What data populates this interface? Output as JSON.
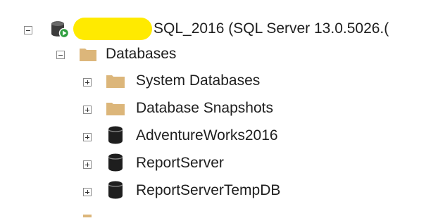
{
  "tree": {
    "server": {
      "label": "SQL_2016 (SQL Server 13.0.5026.(",
      "icon": "database-server-running-icon",
      "expanded": true
    },
    "databases_folder": {
      "label": "Databases",
      "icon": "folder-icon",
      "expanded": true
    },
    "children": [
      {
        "label": "System Databases",
        "icon": "folder-icon",
        "expanded": false
      },
      {
        "label": "Database Snapshots",
        "icon": "folder-icon",
        "expanded": false
      },
      {
        "label": "AdventureWorks2016",
        "icon": "database-icon",
        "expanded": false
      },
      {
        "label": "ReportServer",
        "icon": "database-icon",
        "expanded": false
      },
      {
        "label": "ReportServerTempDB",
        "icon": "database-icon",
        "expanded": false
      }
    ]
  },
  "colors": {
    "folder": "#dcb67a",
    "database": "#1e1e1e",
    "running_badge": "#2e9e3e",
    "redaction": "#ffea00"
  }
}
